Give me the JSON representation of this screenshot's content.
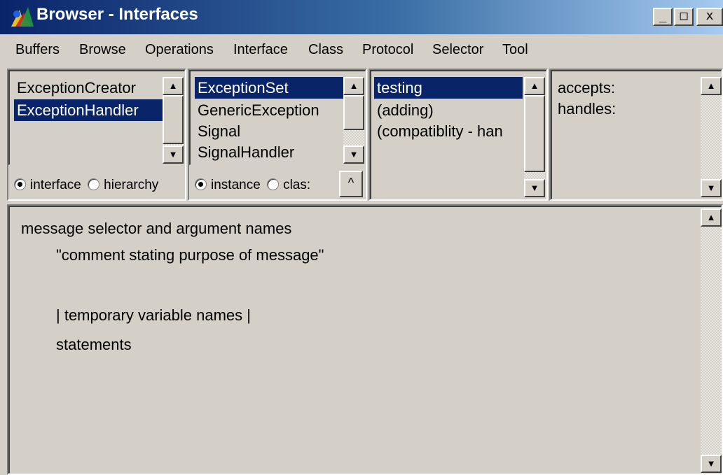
{
  "window": {
    "title": "Browser - Interfaces",
    "controls": {
      "minimize": "_",
      "maximize": "□",
      "close": "x"
    }
  },
  "menu": [
    "Buffers",
    "Browse",
    "Operations",
    "Interface",
    "Class",
    "Protocol",
    "Selector",
    "Tool"
  ],
  "panes": {
    "interfaces": {
      "items": [
        "ExceptionCreator",
        "ExceptionHandler"
      ],
      "selected": "ExceptionHandler"
    },
    "classes": {
      "items": [
        "ExceptionSet",
        "GenericException",
        "Signal",
        "SignalHandler"
      ],
      "selected": "ExceptionSet"
    },
    "protocols": {
      "items": [
        "testing",
        "(adding)",
        "(compatiblity - han"
      ],
      "selected": "testing"
    },
    "selectors": {
      "items": [
        "accepts:",
        "handles:"
      ]
    }
  },
  "radios": {
    "view": {
      "option1": "interface",
      "option2": "hierarchy",
      "selected": "interface"
    },
    "side": {
      "option1": "instance",
      "option2": "class",
      "option2_visible": "clas:",
      "selected": "instance"
    },
    "caret": "^"
  },
  "editor": {
    "lines": [
      "message selector and argument names",
      "\"comment stating purpose of message\"",
      "| temporary variable names |",
      "statements"
    ]
  },
  "icons": {
    "app": "app-logo-icon",
    "scroll_up": "▲",
    "scroll_down": "▼"
  }
}
